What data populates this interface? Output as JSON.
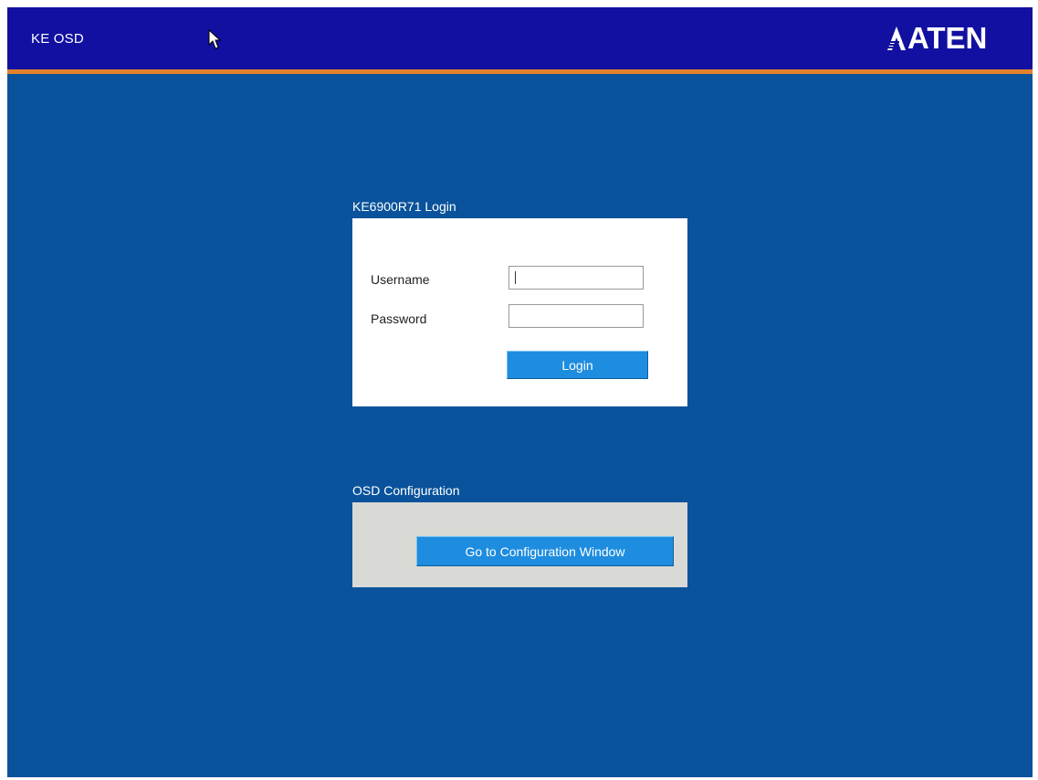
{
  "titlebar": {
    "title": "KE OSD",
    "logo_text": "ATEN",
    "logo_icon": "aten-logo-icon",
    "cursor_icon": "mouse-pointer-icon"
  },
  "login": {
    "section_title": "KE6900R71 Login",
    "username_label": "Username",
    "username_value": "",
    "password_label": "Password",
    "password_value": "",
    "login_button": "Login"
  },
  "config": {
    "section_title": "OSD Configuration",
    "config_button": "Go to Configuration Window"
  },
  "colors": {
    "background": "#0a539c",
    "titlebar": "#1210a0",
    "accent": "#e4822c",
    "button": "#1e8ddf",
    "config_panel": "#d9d9d5"
  }
}
